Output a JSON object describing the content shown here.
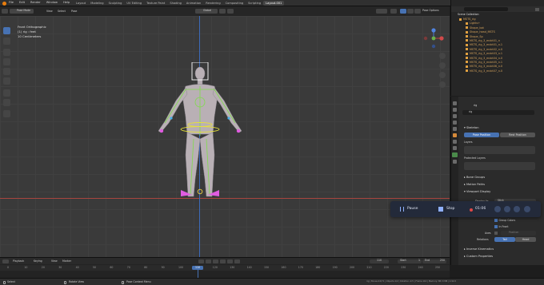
{
  "topbar": {
    "menus": [
      "File",
      "Edit",
      "Render",
      "Window",
      "Help"
    ],
    "workspace_tabs": [
      "Layout",
      "Modeling",
      "Sculpting",
      "UV Editing",
      "Texture Paint",
      "Shading",
      "Animation",
      "Rendering",
      "Compositing",
      "Scripting"
    ],
    "active_tab": "Layout.001",
    "scene_label": "Scene",
    "view_layer_label": "View Layer"
  },
  "viewport_header": {
    "mode": "Pose Mode",
    "menus": [
      "View",
      "Select",
      "Pose"
    ],
    "orientation": "Global",
    "pose_options": "Pose Options"
  },
  "viewport": {
    "view_name": "Front Orthographic",
    "object_info": "(1) rig : feet",
    "scale_info": "10 Centimeters"
  },
  "outliner": {
    "root": "Scene Collection",
    "items": [
      "MSTS_rig",
      "Lights+",
      "Shape_bot",
      "Shape_head_MSTS",
      "Shape_Sp",
      "MSTS_rig_3_mdct01_n",
      "MSTS_rig_3_mdct01_n.1",
      "MSTS_rig_3_mdct02_n.0",
      "MSTS_rig_3_mdct03_n.1",
      "MSTS_rig_3_mdct04_n.0",
      "MSTS_rig_3_mdct05_n.1",
      "MSTS_rig_3_mdct06_n.0",
      "MSTS_rig_3_mdct07_n.0"
    ]
  },
  "properties": {
    "object": "rig",
    "datablock": "rig",
    "skeleton_header": "Skeleton",
    "pose_position": "Pose Position",
    "rest_position": "Rest Position",
    "layers_label": "Layers",
    "protected_layers_label": "Protected Layers",
    "bone_groups": "Bone Groups",
    "motion_paths": "Motion Paths",
    "viewport_display": "Viewport Display",
    "display_as_label": "Display As",
    "display_as_value": "Stick",
    "show_label": "Show",
    "checks": [
      "Names",
      "Shapes",
      "Group Colors",
      "In Front"
    ],
    "axes_label": "Axes",
    "axes_value": "Position",
    "relations_label": "Relations",
    "relations_options": [
      "Tail",
      "Head"
    ],
    "inverse_kinematics": "Inverse Kinematics",
    "custom_properties": "Custom Properties"
  },
  "recorder": {
    "pause": "Pause",
    "stop": "Stop",
    "time": "01:06"
  },
  "timeline": {
    "menus": [
      "Playback",
      "Keying",
      "View",
      "Marker"
    ],
    "current_frame": "110",
    "start_label": "Start",
    "start_value": "1",
    "end_label": "End",
    "end_value": "250",
    "ticks": [
      "0",
      "10",
      "20",
      "30",
      "40",
      "50",
      "60",
      "70",
      "80",
      "90",
      "100",
      "110",
      "120",
      "130",
      "140",
      "150",
      "160",
      "170",
      "180",
      "190",
      "200",
      "210",
      "220",
      "230",
      "240",
      "250"
    ]
  },
  "statusbar": {
    "select": "Select",
    "rotate": "Rotate View",
    "context": "Pose Context Menu",
    "stats": "rig | Bones:24/71 | Objects:1/2 | Rotation:-0.5 | Frame 110 | Memory: 88.3 MiB | 2.92.0"
  },
  "colors": {
    "accent": "#4772b3",
    "bone_green": "#7fdc4a",
    "bone_yellow": "#e6e03a",
    "bone_pink": "#e05ce0",
    "axis_red": "#a8453f"
  }
}
